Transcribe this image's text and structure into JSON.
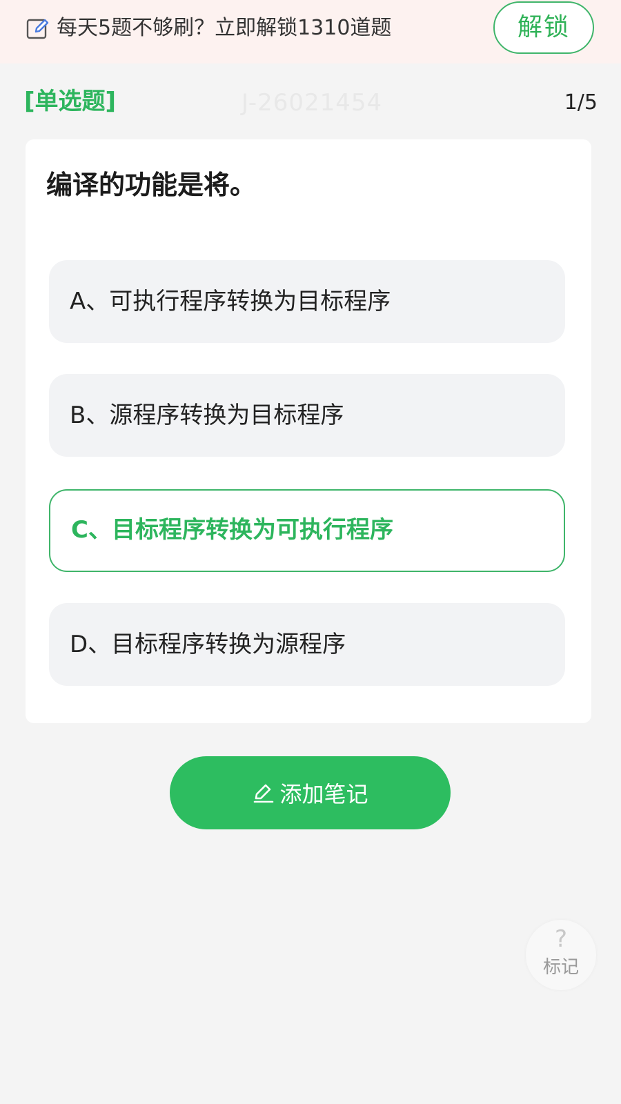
{
  "banner": {
    "icon": "edit-icon",
    "text": "每天5题不够刷？立即解锁1310道题",
    "unlock_label": "解锁"
  },
  "question": {
    "type_label": "[单选题]",
    "id": "J-26021454",
    "progress": "1/5",
    "stem": "编译的功能是将。",
    "options": [
      {
        "label": "A、可执行程序转换为目标程序",
        "selected": false
      },
      {
        "label": "B、源程序转换为目标程序",
        "selected": false
      },
      {
        "label": "C、目标程序转换为可执行程序",
        "selected": true
      },
      {
        "label": "D、目标程序转换为源程序",
        "selected": false
      }
    ]
  },
  "actions": {
    "add_note_label": "添加笔记",
    "add_note_icon": "pen-icon",
    "mark_label": "标记",
    "mark_icon_glyph": "?"
  },
  "colors": {
    "accent": "#2db55d",
    "banner_bg": "#fdf2f0",
    "option_bg": "#f2f3f5"
  }
}
